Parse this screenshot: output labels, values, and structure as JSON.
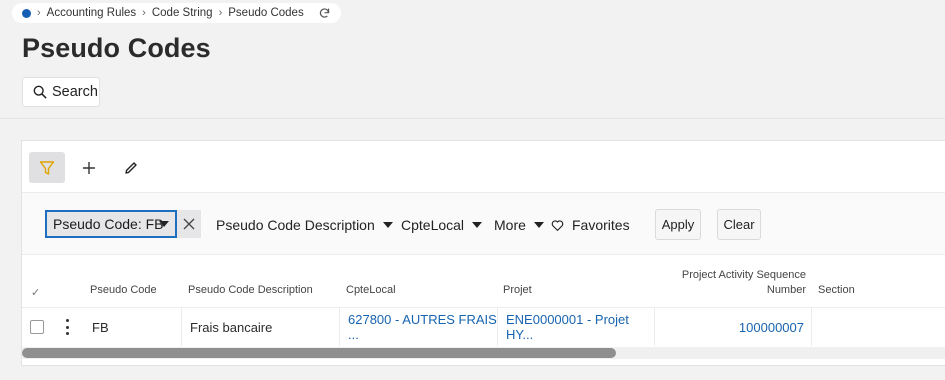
{
  "breadcrumb": {
    "items": [
      "Accounting Rules",
      "Code String",
      "Pseudo Codes"
    ]
  },
  "page": {
    "title": "Pseudo Codes",
    "search_label": "Search"
  },
  "filters": {
    "active_chip": "Pseudo Code: FB",
    "items": [
      "Pseudo Code Description",
      "CpteLocal",
      "More"
    ],
    "favorites_label": "Favorites",
    "apply_label": "Apply",
    "clear_label": "Clear"
  },
  "table": {
    "headers": {
      "check": "✓",
      "pseudo_code": "Pseudo Code",
      "description": "Pseudo Code Description",
      "cpte_local": "CpteLocal",
      "projet": "Projet",
      "activity_line1": "Project Activity Sequence",
      "activity_line2": "Number",
      "section": "Section"
    },
    "rows": [
      {
        "pseudo_code": "FB",
        "description": "Frais bancaire",
        "cpte_local": "627800 - AUTRES FRAIS ...",
        "projet": "ENE0000001 - Projet HY...",
        "activity_seq": "100000007",
        "section": ""
      }
    ]
  },
  "colors": {
    "accent": "#1f6fbf",
    "link": "#1864b0",
    "filter_icon": "#e0a400"
  },
  "scroll": {
    "thumb_fraction": 0.64
  }
}
